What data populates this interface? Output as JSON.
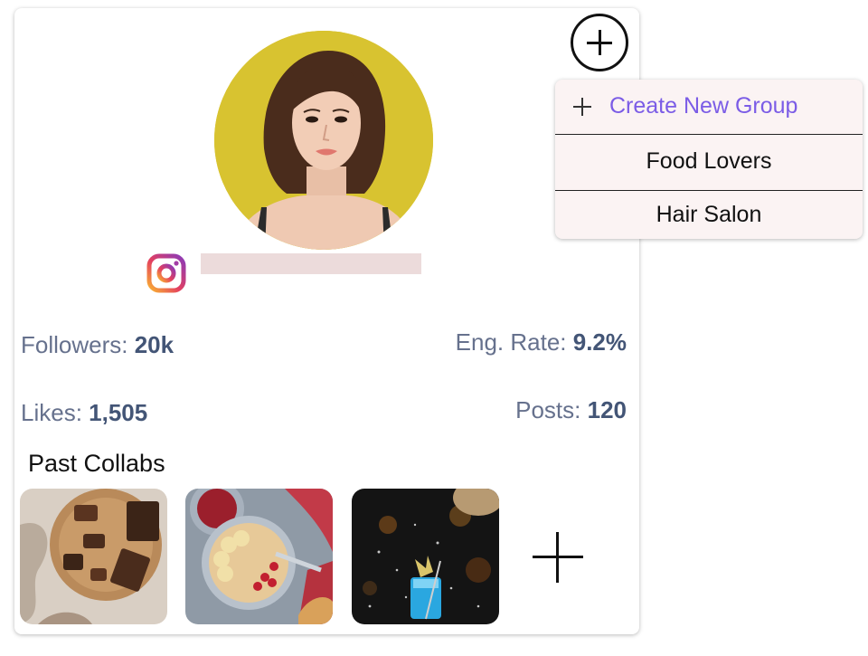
{
  "profile": {
    "avatar_icon": "person-portrait",
    "platform_icon": "instagram-icon",
    "username": ""
  },
  "stats": {
    "followers_label": "Followers: ",
    "followers_value": "20k",
    "eng_rate_label": "Eng. Rate: ",
    "eng_rate_value": "9.2%",
    "likes_label": "Likes: ",
    "likes_value": "1,505",
    "posts_label": "Posts: ",
    "posts_value": "120"
  },
  "collabs": {
    "title": "Past Collabs",
    "items": [
      "chocolate-photo",
      "oatmeal-bowl-photo",
      "cocktail-bar-photo"
    ]
  },
  "group_menu": {
    "create_label": "Create New Group",
    "groups": [
      "Food Lovers",
      "Hair Salon"
    ]
  },
  "colors": {
    "accent": "#7b5ce6",
    "stat_label": "#66718d",
    "stat_value": "#435576",
    "menu_bg": "#fbf3f3"
  }
}
